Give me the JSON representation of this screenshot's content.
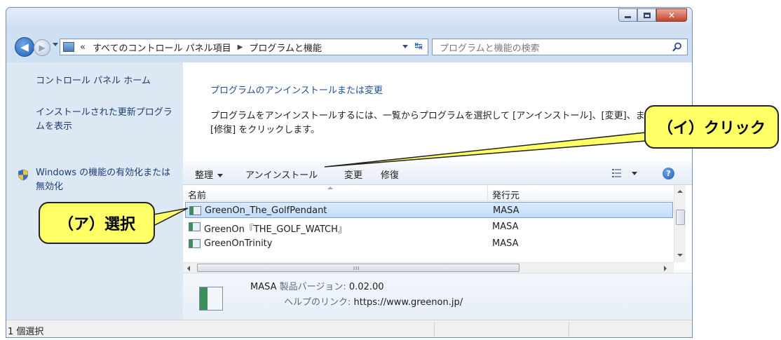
{
  "window": {
    "controls": {
      "minimize": "minimize",
      "maximize": "maximize",
      "close": "✕"
    }
  },
  "address": {
    "lead": "«",
    "crumbs": [
      "すべてのコントロール パネル項目",
      "プログラムと機能"
    ],
    "separator": "▶"
  },
  "search": {
    "placeholder": "プログラムと機能の検索"
  },
  "sidebar": {
    "items": [
      {
        "label": "コントロール パネル ホーム"
      },
      {
        "label": "インストールされた更新プログラムを表示"
      },
      {
        "label": "Windows の機能の有効化または無効化"
      }
    ]
  },
  "main": {
    "title": "プログラムのアンインストールまたは変更",
    "description": "プログラムをアンインストールするには、一覧からプログラムを選択して [アンインストール]、[変更]、または [修復] をクリックします。"
  },
  "toolbar": {
    "organize": "整理",
    "uninstall": "アンインストール",
    "change": "変更",
    "repair": "修復",
    "help": "?"
  },
  "list": {
    "columns": {
      "name": "名前",
      "publisher": "発行元"
    },
    "rows": [
      {
        "name": "GreenOn_The_GolfPendant",
        "publisher": "MASA",
        "selected": true
      },
      {
        "name": "GreenOn『THE_GOLF_WATCH』",
        "publisher": "MASA",
        "selected": false
      },
      {
        "name": "GreenOnTrinity",
        "publisher": "MASA",
        "selected": false
      }
    ],
    "hscroll_grip": "III"
  },
  "details": {
    "publisher": "MASA",
    "version_label": "製品バージョン:",
    "version": "0.02.00",
    "help_label": "ヘルプのリンク:",
    "help_link": "https://www.greenon.jp/"
  },
  "status": {
    "text": "1 個選択"
  },
  "annotations": {
    "select": "（ア）選択",
    "click": "（イ）クリック",
    "callout_fill": "#ffff66"
  },
  "colors": {
    "link": "#1e4e9c",
    "selection": "#c1dcfc",
    "sidebar_bg": "#dde8f5"
  }
}
